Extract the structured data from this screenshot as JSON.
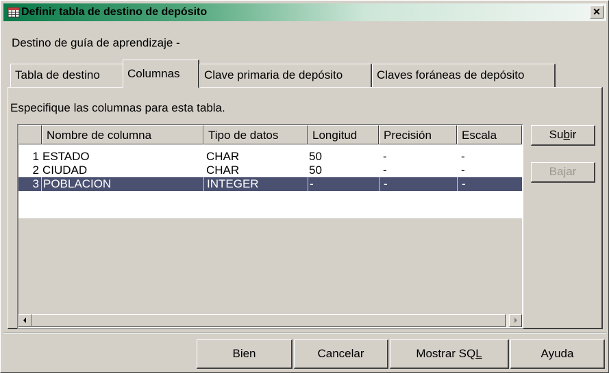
{
  "window": {
    "title": "Definir tabla de destino de depósito",
    "close_label": "✕",
    "subtitle": "Destino de guía de aprendizaje -"
  },
  "tabs": [
    {
      "label": "Tabla de destino",
      "active": false
    },
    {
      "label": "Columnas",
      "active": true
    },
    {
      "label": "Clave primaria de depósito",
      "active": false
    },
    {
      "label": "Claves foráneas de depósito",
      "active": false
    }
  ],
  "panel": {
    "instructions": "Especifique las columnas para esta tabla."
  },
  "table": {
    "columns": [
      "",
      "Nombre de columna",
      "Tipo de datos",
      "Longitud",
      "Precisión",
      "Escala"
    ],
    "rows": [
      {
        "num": "1",
        "name": "ESTADO",
        "type": "CHAR",
        "length": "50",
        "precision": "-",
        "scale": "-"
      },
      {
        "num": "2",
        "name": "CIUDAD",
        "type": "CHAR",
        "length": "50",
        "precision": "-",
        "scale": "-"
      },
      {
        "num": "3",
        "name": "POBLACION",
        "type": "INTEGER",
        "length": "-",
        "precision": "-",
        "scale": "-"
      }
    ],
    "selected_row": 3
  },
  "side_buttons": {
    "up": {
      "pre": "Su",
      "mnemonic": "b",
      "post": "ir",
      "enabled": true
    },
    "down": {
      "pre": "Ba",
      "mnemonic": "j",
      "post": "ar",
      "enabled": false
    }
  },
  "footer": {
    "ok": "Bien",
    "cancel": "Cancelar",
    "show_sql_pre": "Mostrar SQ",
    "show_sql_mnemonic": "L",
    "help": "Ayuda"
  },
  "colors": {
    "selection": "#4a5070",
    "title_gradient_start": "#0a7a4a",
    "face": "#d4d0c8"
  }
}
